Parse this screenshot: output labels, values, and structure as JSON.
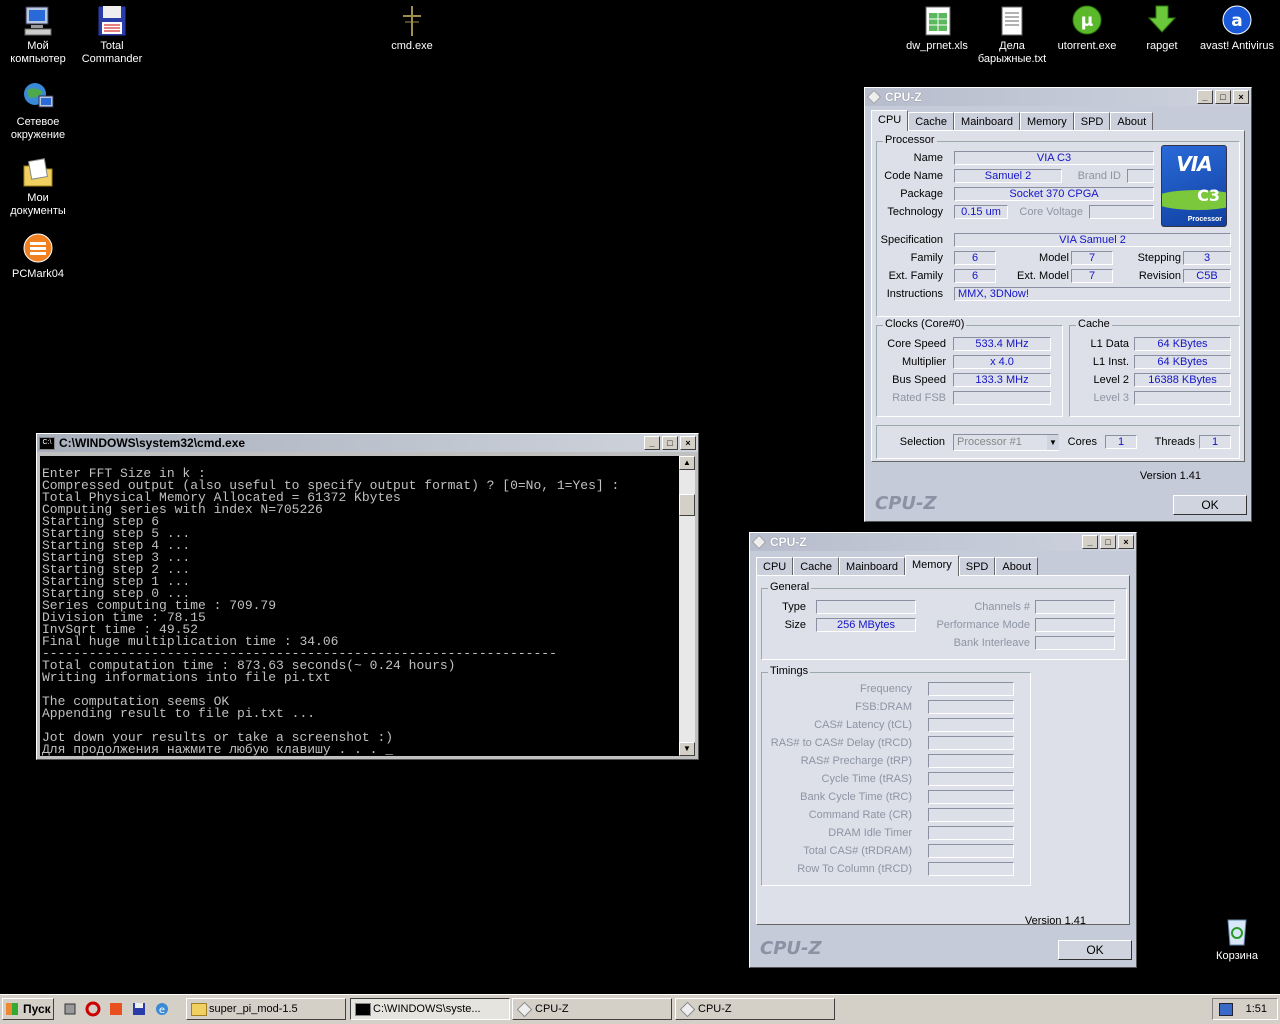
{
  "desktop_icons": {
    "my_computer": "Мой компьютер",
    "total_commander": "Total Commander",
    "network": "Сетевое окружение",
    "my_documents": "Мои документы",
    "pcmark": "PCMark04",
    "cmd": "cmd.exe",
    "xls": "dw_prnet.xls",
    "txt": "Дела барыжные.txt",
    "utorrent": "utorrent.exe",
    "rapget": "rapget",
    "avast": "avast! Antivirus",
    "recycle": "Корзина"
  },
  "cmd_window": {
    "title": "C:\\WINDOWS\\system32\\cmd.exe",
    "lines": [
      "Enter FFT Size in k :",
      "Compressed output (also useful to specify output format) ? [0=No, 1=Yes] :",
      "Total Physical Memory Allocated = 61372 Kbytes",
      "Computing series with index N=705226",
      "Starting step 6",
      "Starting step 5 ...",
      "Starting step 4 ...",
      "Starting step 3 ...",
      "Starting step 2 ...",
      "Starting step 1 ...",
      "Starting step 0 ...",
      "Series computing time : 709.79",
      "Division time : 78.15",
      "InvSqrt time : 49.52",
      "Final huge multiplication time : 34.06",
      "------------------------------------------------------------------",
      "Total computation time : 873.63 seconds(~ 0.24 hours)",
      "Writing informations into file pi.txt",
      "",
      "The computation seems OK",
      "Appending result to file pi.txt ...",
      "",
      "Jot down your results or take a screenshot :)",
      "Для продолжения нажмите любую клавишу . . . _"
    ]
  },
  "cpuz1": {
    "title": "CPU-Z",
    "tabs": [
      "CPU",
      "Cache",
      "Mainboard",
      "Memory",
      "SPD",
      "About"
    ],
    "active_tab": "CPU",
    "processor_group": "Processor",
    "name_label": "Name",
    "name": "VIA C3",
    "codename_label": "Code Name",
    "codename": "Samuel 2",
    "brandid_label": "Brand ID",
    "brandid": "",
    "package_label": "Package",
    "package": "Socket 370 CPGA",
    "technology_label": "Technology",
    "technology": "0.15 um",
    "corevoltage_label": "Core Voltage",
    "corevoltage": "",
    "logo_brand": "VIA",
    "logo_model": "C3",
    "logo_sub": "Processor",
    "spec_label": "Specification",
    "spec": "VIA Samuel 2",
    "family_label": "Family",
    "family": "6",
    "model_label": "Model",
    "model": "7",
    "stepping_label": "Stepping",
    "stepping": "3",
    "extfamily_label": "Ext. Family",
    "extfamily": "6",
    "extmodel_label": "Ext. Model",
    "extmodel": "7",
    "revision_label": "Revision",
    "revision": "C5B",
    "instructions_label": "Instructions",
    "instructions": "MMX, 3DNow!",
    "clocks_group": "Clocks (Core#0)",
    "corespeed_label": "Core Speed",
    "corespeed": "533.4 MHz",
    "multiplier_label": "Multiplier",
    "multiplier": "x 4.0",
    "busspeed_label": "Bus Speed",
    "busspeed": "133.3 MHz",
    "ratedfsb_label": "Rated FSB",
    "ratedfsb": "",
    "cache_group": "Cache",
    "l1data_label": "L1 Data",
    "l1data": "64 KBytes",
    "l1inst_label": "L1 Inst.",
    "l1inst": "64 KBytes",
    "level2_label": "Level 2",
    "level2": "16388 KBytes",
    "level3_label": "Level 3",
    "level3": "",
    "selection_label": "Selection",
    "selection": "Processor #1",
    "cores_label": "Cores",
    "cores": "1",
    "threads_label": "Threads",
    "threads": "1",
    "version": "Version 1.41",
    "brand_text": "CPU-Z",
    "ok": "OK"
  },
  "cpuz2": {
    "title": "CPU-Z",
    "tabs": [
      "CPU",
      "Cache",
      "Mainboard",
      "Memory",
      "SPD",
      "About"
    ],
    "active_tab": "Memory",
    "general_group": "General",
    "type_label": "Type",
    "type": "",
    "size_label": "Size",
    "size": "256 MBytes",
    "channels_label": "Channels #",
    "channels": "",
    "perfmode_label": "Performance Mode",
    "perfmode": "",
    "bankint_label": "Bank Interleave",
    "bankint": "",
    "timings_group": "Timings",
    "timings": [
      "Frequency",
      "FSB:DRAM",
      "CAS# Latency (tCL)",
      "RAS# to CAS# Delay (tRCD)",
      "RAS# Precharge (tRP)",
      "Cycle Time (tRAS)",
      "Bank Cycle Time (tRC)",
      "Command Rate (CR)",
      "DRAM Idle Timer",
      "Total CAS# (tRDRAM)",
      "Row To Column (tRCD)"
    ],
    "version": "Version 1.41",
    "brand_text": "CPU-Z",
    "ok": "OK"
  },
  "taskbar": {
    "start": "Пуск",
    "tasks": [
      "super_pi_mod-1.5",
      "C:\\WINDOWS\\syste...",
      "CPU-Z",
      "CPU-Z"
    ],
    "clock": "1:51"
  }
}
